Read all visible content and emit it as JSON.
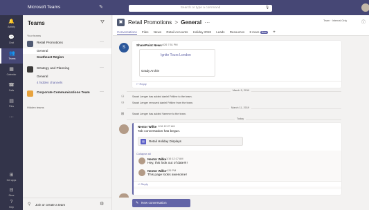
{
  "titlebar": {
    "app_name": "Microsoft Teams",
    "search_placeholder": "Search or type a command"
  },
  "rail": {
    "items": [
      {
        "label": "Activity",
        "icon": "bell-icon"
      },
      {
        "label": "Chat",
        "icon": "chat-icon"
      },
      {
        "label": "Teams",
        "icon": "teams-icon"
      },
      {
        "label": "Calendar",
        "icon": "calendar-icon"
      },
      {
        "label": "Calls",
        "icon": "phone-icon"
      },
      {
        "label": "Files",
        "icon": "files-icon"
      },
      {
        "label": "",
        "icon": "more-icon"
      },
      {
        "label": "Get apps",
        "icon": "apps-icon"
      },
      {
        "label": "Store",
        "icon": "store-icon"
      },
      {
        "label": "Help",
        "icon": "help-icon"
      }
    ]
  },
  "teams_pane": {
    "title": "Teams",
    "section_label": "Your teams",
    "teams": [
      {
        "name": "Retail Promotions",
        "color": "#505a73"
      },
      {
        "name": "Strategy and Planning",
        "color": "#3b3a39"
      },
      {
        "name": "Corporate Communications Team",
        "color": "#e8a33d"
      }
    ],
    "channels_retail": [
      "General",
      "Southeast Region"
    ],
    "channels_strategy": [
      "General",
      "4 hidden channels"
    ],
    "hidden_label": "Hidden teams",
    "join_label": "Join or create a team"
  },
  "channel": {
    "team": "Retail Promotions",
    "separator": ">",
    "name": "General",
    "ellipsis": "···",
    "org_badge": "Team · Internal Only",
    "tabs": [
      "Conversations",
      "Files",
      "News",
      "Retail Accounts",
      "Holiday 2018",
      "Leads",
      "Resources"
    ],
    "more_tabs": "8 more",
    "more_badge": "New"
  },
  "feed": {
    "sharepoint": {
      "sender": "SharePoint News",
      "time": "4/26 7:51 PM",
      "link": "Ignite Tours London",
      "person": "Grady Archie",
      "reply": "Reply"
    },
    "date1": "March 5, 2019",
    "sys1": "Sarah Lenger has added daniel Fritline to the team.",
    "sys2": "Sarah Lenger removed daniel Fritline from the team.",
    "date2": "March 11, 2019",
    "sys3": "Sarah Lenger has added Yammer to the team.",
    "today": "Today",
    "post": {
      "author": "Nestor Wilke",
      "time": "1/16 12:27 AM",
      "text": "Tab conversation has begun.",
      "attachment": "Retail Holiday Displays",
      "collapse": "Collapse all",
      "replies": [
        {
          "author": "Nestor Wilke",
          "time": "1/16 12:17 AM",
          "text": "Hey, this look out of date!!!!"
        },
        {
          "author": "Nestor Wilke",
          "time": "4:26 PM",
          "text": "This page looks awesome!"
        }
      ],
      "reply": "Reply"
    }
  },
  "compose": {
    "label": "New conversation"
  }
}
